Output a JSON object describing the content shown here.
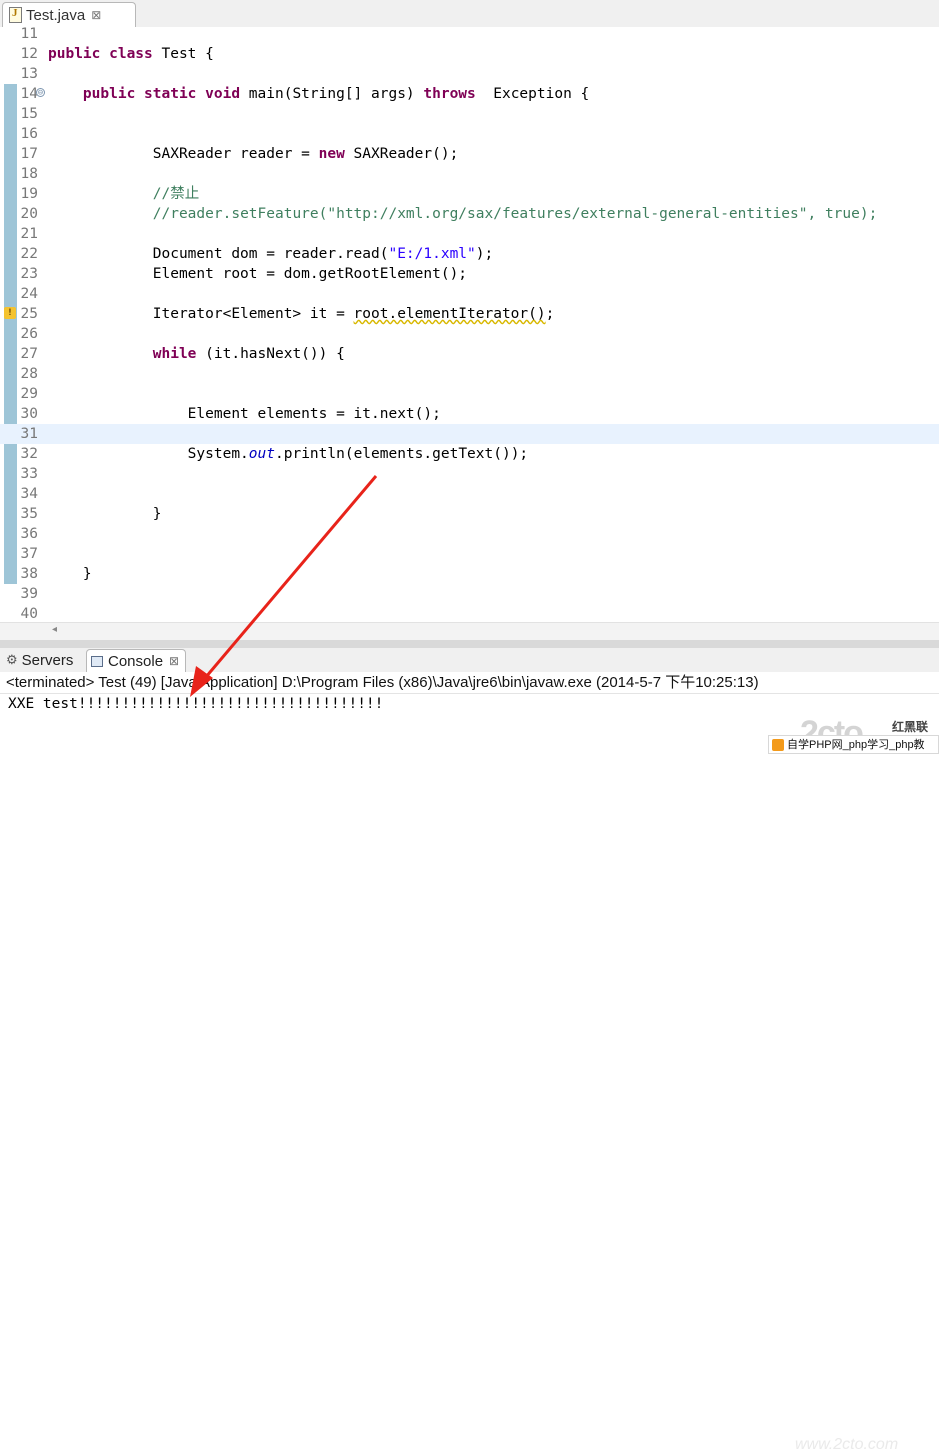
{
  "editor": {
    "tab": {
      "title": "Test.java",
      "close": "⊠"
    },
    "lines": [
      {
        "num": "11",
        "segments": []
      },
      {
        "num": "12",
        "segments": [
          {
            "t": "public class",
            "c": "kw"
          },
          {
            "t": " Test {",
            "c": ""
          }
        ]
      },
      {
        "num": "13",
        "segments": []
      },
      {
        "num": "14",
        "fold": "⊖",
        "segments": [
          {
            "t": "    ",
            "c": ""
          },
          {
            "t": "public static void",
            "c": "kw"
          },
          {
            "t": " main(String[] args) ",
            "c": ""
          },
          {
            "t": "throws",
            "c": "kw"
          },
          {
            "t": "  Exception {",
            "c": ""
          }
        ]
      },
      {
        "num": "15",
        "segments": []
      },
      {
        "num": "16",
        "segments": []
      },
      {
        "num": "17",
        "segments": [
          {
            "t": "            SAXReader reader = ",
            "c": ""
          },
          {
            "t": "new",
            "c": "kw"
          },
          {
            "t": " SAXReader();",
            "c": ""
          }
        ]
      },
      {
        "num": "18",
        "segments": []
      },
      {
        "num": "19",
        "segments": [
          {
            "t": "            ",
            "c": ""
          },
          {
            "t": "//禁止",
            "c": "cm"
          }
        ]
      },
      {
        "num": "20",
        "segments": [
          {
            "t": "            ",
            "c": ""
          },
          {
            "t": "//reader.setFeature(\"http://xml.org/sax/features/external-general-entities\", true);",
            "c": "cm"
          }
        ]
      },
      {
        "num": "21",
        "segments": []
      },
      {
        "num": "22",
        "segments": [
          {
            "t": "            Document dom = reader.read(",
            "c": ""
          },
          {
            "t": "\"E:/1.xml\"",
            "c": "str"
          },
          {
            "t": ");",
            "c": ""
          }
        ]
      },
      {
        "num": "23",
        "segments": [
          {
            "t": "            Element root = dom.getRootElement();",
            "c": ""
          }
        ]
      },
      {
        "num": "24",
        "segments": []
      },
      {
        "num": "25",
        "warn": "!",
        "segments": [
          {
            "t": "            Iterator<Element> it = ",
            "c": ""
          },
          {
            "t": "root.elementIterator()",
            "c": "warn-underline"
          },
          {
            "t": ";",
            "c": ""
          }
        ]
      },
      {
        "num": "26",
        "segments": []
      },
      {
        "num": "27",
        "segments": [
          {
            "t": "            ",
            "c": ""
          },
          {
            "t": "while",
            "c": "kw"
          },
          {
            "t": " (it.hasNext()) {",
            "c": ""
          }
        ]
      },
      {
        "num": "28",
        "segments": []
      },
      {
        "num": "29",
        "segments": []
      },
      {
        "num": "30",
        "segments": [
          {
            "t": "                Element elements = it.next();",
            "c": ""
          }
        ]
      },
      {
        "num": "31",
        "current": true,
        "segments": []
      },
      {
        "num": "32",
        "segments": [
          {
            "t": "                System.",
            "c": ""
          },
          {
            "t": "out",
            "c": "field"
          },
          {
            "t": ".println(elements.getText());",
            "c": ""
          }
        ]
      },
      {
        "num": "33",
        "segments": []
      },
      {
        "num": "34",
        "segments": []
      },
      {
        "num": "35",
        "segments": [
          {
            "t": "            }",
            "c": ""
          }
        ]
      },
      {
        "num": "36",
        "segments": []
      },
      {
        "num": "37",
        "segments": []
      },
      {
        "num": "38",
        "segments": [
          {
            "t": "    }",
            "c": ""
          }
        ]
      },
      {
        "num": "39",
        "segments": []
      },
      {
        "num": "40",
        "segments": []
      }
    ]
  },
  "bottom_panel": {
    "servers_tab": "Servers",
    "console_tab": "Console",
    "console_close": "⊠",
    "status": "<terminated> Test (49) [Java Application] D:\\Program Files (x86)\\Java\\jre6\\bin\\javaw.exe (2014-5-7 下午10:25:13)",
    "output": "XXE test!!!!!!!!!!!!!!!!!!!!!!!!!!!!!!!!!!!"
  },
  "watermark": {
    "logo": "2cto",
    "logo_sub": "红黑联盟",
    "bar_text": "自学PHP网_php学习_php教"
  },
  "colors": {
    "keyword": "#7f0055",
    "comment": "#3f7f5f",
    "string": "#2a00ff",
    "arrow": "#e8231a",
    "current_line": "#e8f2fe"
  }
}
